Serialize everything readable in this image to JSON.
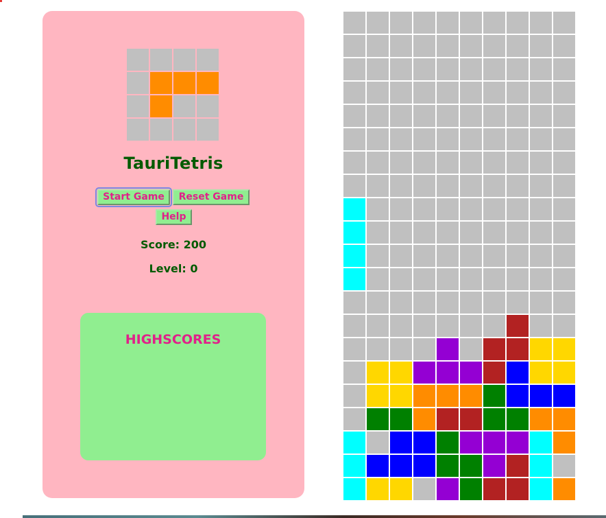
{
  "app": {
    "title": "TauriTetris"
  },
  "controls": {
    "start_label": "Start Game",
    "reset_label": "Reset Game",
    "help_label": "Help"
  },
  "stats": {
    "score_text": "Score: 200",
    "level_text": "Level: 0",
    "score": 200,
    "level": 0
  },
  "highscores": {
    "title": "HIGHSCORES",
    "entries": []
  },
  "colors": {
    "empty": "#c0c0c0",
    "I": "#00ffff",
    "O": "#ffd700",
    "T": "#9400d3",
    "L": "#ff8c00",
    "J": "#0000ff",
    "S": "#008000",
    "Z": "#b22222"
  },
  "next_piece": {
    "name": "L",
    "grid": [
      "....",
      ".LLL",
      ".L..",
      "...."
    ]
  },
  "board": {
    "columns": 10,
    "rows": 21,
    "grid": [
      "..........",
      "..........",
      "..........",
      "..........",
      "..........",
      "..........",
      "..........",
      "..........",
      "I.........",
      "I.........",
      "I.........",
      "I.........",
      "..........",
      ".......Z..",
      "....T.ZZOO",
      ".OOTTTZJOO",
      ".OOLLLSJJJ",
      ".SSLZZSSLL",
      "I.JJSTTTIL",
      "IJJJSSTZI.",
      "IOO.TSZZIL"
    ]
  }
}
